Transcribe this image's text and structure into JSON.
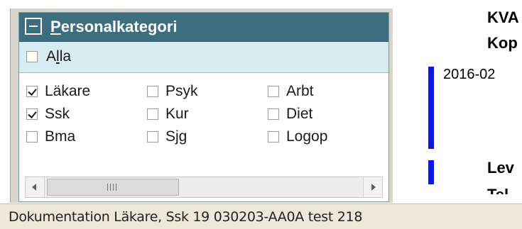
{
  "personal_panel": {
    "title_first_letter": "P",
    "title_rest": "ersonalkategori",
    "alla": {
      "label_start": "A",
      "label_accel": "l",
      "label_end": "la",
      "checked": false
    },
    "categories": [
      {
        "label": "Läkare",
        "checked": true
      },
      {
        "label": "Psyk",
        "checked": false
      },
      {
        "label": "Arbt",
        "checked": false
      },
      {
        "label": "Ssk",
        "checked": true
      },
      {
        "label": "Kur",
        "checked": false
      },
      {
        "label": "Diet",
        "checked": false
      },
      {
        "label": "Bma",
        "checked": false
      },
      {
        "label": "Sjg",
        "checked": false
      },
      {
        "label": "Logop",
        "checked": false
      }
    ]
  },
  "right_panel": {
    "heading_line1": "KVA",
    "heading_line2": "Kop",
    "date": "2016-02",
    "heading_line3": "Lev",
    "heading_line4": "Tel"
  },
  "status_bar": {
    "text": "Dokumentation Läkare, Ssk 19 030203-AA0A test 218"
  },
  "colors": {
    "header_bg": "#3d6e80",
    "alla_row_bg": "#d7ecf0",
    "marker_blue": "#0a19e8"
  }
}
